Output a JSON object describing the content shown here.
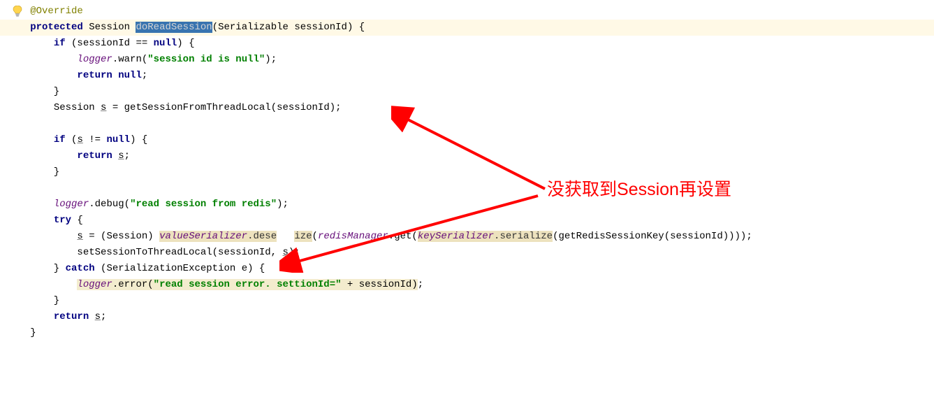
{
  "annotation_text": "没获取到Session再设置",
  "code": {
    "override": "@Override",
    "kw_protected": "protected",
    "type_session": "Session",
    "method_name": "doReadSession",
    "param_type": "Serializable",
    "param_name": "sessionId",
    "kw_if": "if",
    "kw_null": "null",
    "kw_return": "return",
    "kw_try": "try",
    "kw_catch": "catch",
    "logger": "logger",
    "warn": "warn",
    "debug": "debug",
    "error": "error",
    "str_session_null": "\"session id is null\"",
    "str_read_session": "\"read session from redis\"",
    "str_read_error": "\"read session error. settionId=\"",
    "var_s": "s",
    "get_from_thread": "getSessionFromThreadLocal",
    "cast_session": "Session",
    "value_serializer": "valueSerializer",
    "deserialize_a": "dese",
    "deserialize_b": "ize",
    "redis_manager": "redisManager",
    "get": "get",
    "key_serializer": "keySerializer",
    "serialize": "serialize",
    "get_redis_key": "getRedisSessionKey",
    "set_to_thread": "setSessionToThreadLocal",
    "exception_type": "SerializationException",
    "exception_var": "e"
  }
}
